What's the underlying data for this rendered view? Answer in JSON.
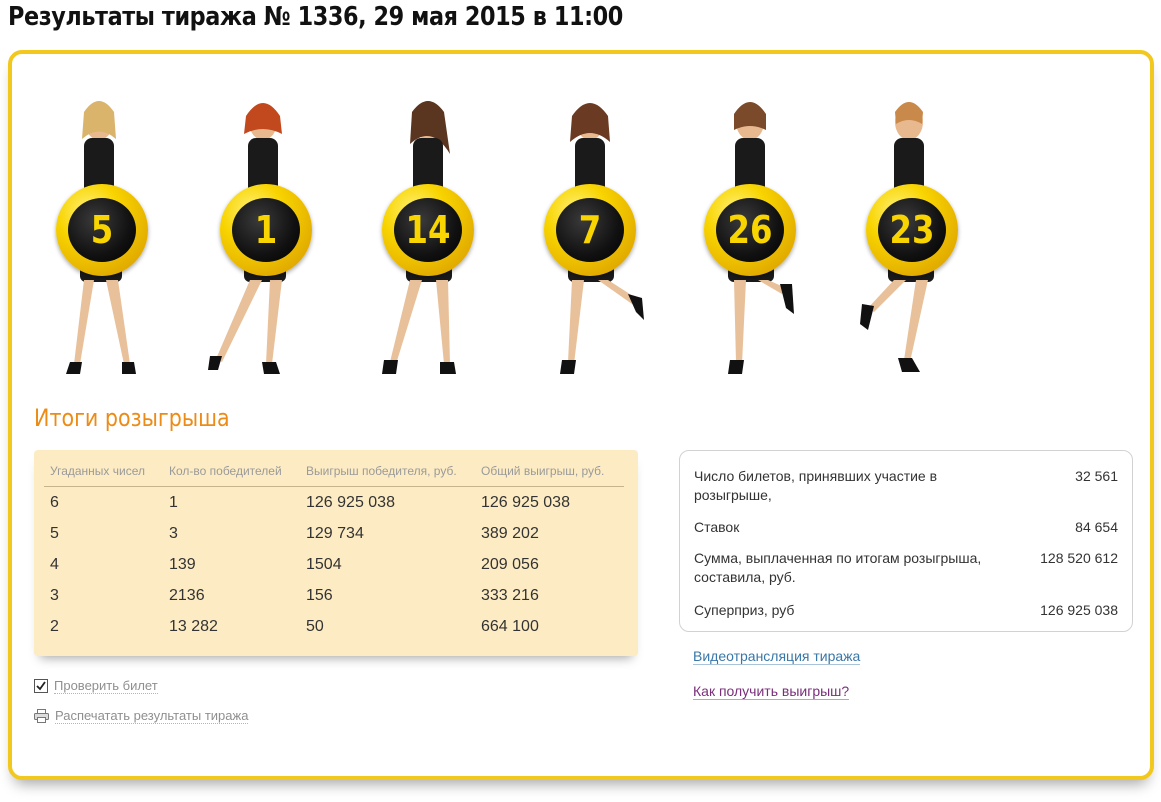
{
  "page": {
    "title": "Результаты тиража № 1336, 29 мая 2015 в 11:00"
  },
  "draw": {
    "balls": [
      "5",
      "1",
      "14",
      "7",
      "26",
      "23"
    ]
  },
  "results": {
    "title": "Итоги розыгрыша",
    "columns": [
      "Угаданных чисел",
      "Кол-во победителей",
      "Выигрыш победителя, руб.",
      "Общий выигрыш, руб."
    ],
    "rows": [
      [
        "6",
        "1",
        "126 925 038",
        "126 925 038"
      ],
      [
        "5",
        "3",
        "129 734",
        "389 202"
      ],
      [
        "4",
        "139",
        "1504",
        "209 056"
      ],
      [
        "3",
        "2136",
        "156",
        "333 216"
      ],
      [
        "2",
        "13 282",
        "50",
        "664 100"
      ]
    ]
  },
  "stats": {
    "tickets_label": "Число билетов, принявших участие в розыгрыше,",
    "tickets_value": "32 561",
    "bets_label": "Ставок",
    "bets_value": "84 654",
    "paid_label": "Сумма, выплаченная по итогам розыгрыша, составила, руб.",
    "paid_value": "128 520 612",
    "superprize_label": "Суперприз, руб",
    "superprize_value": "126 925 038"
  },
  "links": {
    "check_ticket": "Проверить билет",
    "print_results": "Распечатать результаты тиража",
    "video": "Видеотрансляция тиража",
    "how_to_get": "Как получить выигрыш?"
  },
  "colors": {
    "accent_yellow": "#f3c81e",
    "section_title": "#ec8c17",
    "table_bg": "#fdecc3",
    "link_blue": "#3977a8",
    "link_purple": "#7a2f7a"
  },
  "icons": {
    "check_ticket": "checkbox-checked-icon",
    "print_results": "printer-icon"
  }
}
